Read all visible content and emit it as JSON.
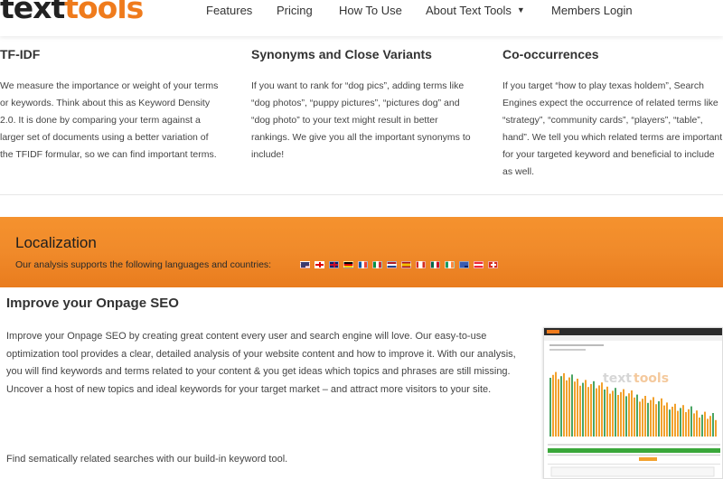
{
  "header": {
    "logo_text_1": "text",
    "logo_text_2": "tools",
    "nav": [
      {
        "label": "Features"
      },
      {
        "label": "Pricing"
      },
      {
        "label": "How To Use"
      },
      {
        "label": "About Text Tools"
      },
      {
        "label": "Members Login"
      }
    ]
  },
  "features": [
    {
      "title": "TF-IDF",
      "text": "We measure the importance or weight of your terms or keywords. Think about this as Keyword Density 2.0. It is done by comparing your term against a larger set of documents using a better variation of the TFIDF formular, so we can find important terms."
    },
    {
      "title": "Synonyms and Close Variants",
      "text": "If you want to rank for “dog pics”, adding terms like “dog photos”, “puppy pictures”, “pictures dog” and “dog photo” to your text might result in better rankings. We give you all the important synonyms to include!"
    },
    {
      "title": "Co-occurrences",
      "text": "If you target “how to play texas holdem”, Search Engines expect the occurrence of related terms like “strategy”, “community cards”, “players”, “table”, hand”. We tell you which related terms are important for your targeted keyword and beneficial to include as well."
    }
  ],
  "localization": {
    "title": "Localization",
    "subtitle": "Our analysis supports the following languages and countries:",
    "flags": [
      "us-flag-icon",
      "uk-flag-icon",
      "gb-flag-icon",
      "de-flag-icon",
      "fr-flag-icon",
      "it-flag-icon",
      "nl-flag-icon",
      "es-flag-icon",
      "ca-flag-icon",
      "mx-flag-icon",
      "ie-flag-icon",
      "au-flag-icon",
      "at-flag-icon",
      "ch-flag-icon"
    ]
  },
  "seo": {
    "title": "Improve your Onpage SEO",
    "text": "Improve your Onpage SEO by creating great content every user and search engine will love. Our easy-to-use optimization tool provides a clear, detailed analysis of your website content and how to improve it. With our analysis, you will find keywords and terms related to your content & you get ideas which topics and phrases are still missing. Uncover a host of new topics and ideal keywords for your target market – and attract more visitors to your site.",
    "footer": "Find sematically related searches with our build-in keyword tool."
  },
  "colors": {
    "accent": "#ef7b1c",
    "banner": "#f08a2a"
  }
}
